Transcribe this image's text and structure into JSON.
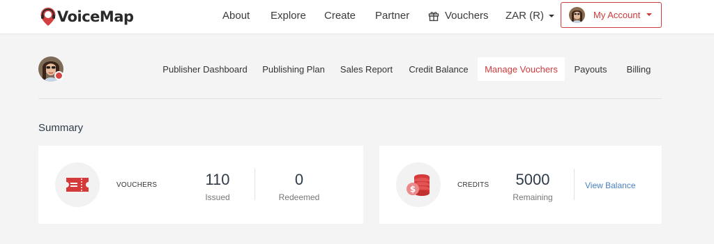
{
  "brand": {
    "name": "VoiceMap",
    "accent": "#cc3b3b",
    "link_color": "#4a7fc1"
  },
  "topnav": {
    "about": "About",
    "explore": "Explore",
    "create": "Create",
    "partner": "Partner",
    "vouchers": "Vouchers",
    "vouchers_icon": "gift-icon",
    "currency": "ZAR (R)",
    "account": "My Account"
  },
  "subnav": {
    "items": [
      {
        "label": "Publisher Dashboard"
      },
      {
        "label": "Publishing Plan"
      },
      {
        "label": "Sales Report"
      },
      {
        "label": "Credit Balance"
      },
      {
        "label": "Manage Vouchers",
        "active": true
      },
      {
        "label": "Payouts"
      },
      {
        "label": "Billing"
      }
    ]
  },
  "summary": {
    "title": "Summary",
    "vouchers": {
      "icon": "ticket-icon",
      "label": "VOUCHERS",
      "issued_value": "110",
      "issued_caption": "Issued",
      "redeemed_value": "0",
      "redeemed_caption": "Redeemed"
    },
    "credits": {
      "icon": "coins-icon",
      "label": "CREDITS",
      "remaining_value": "5000",
      "remaining_caption": "Remaining",
      "link": "View Balance"
    }
  }
}
